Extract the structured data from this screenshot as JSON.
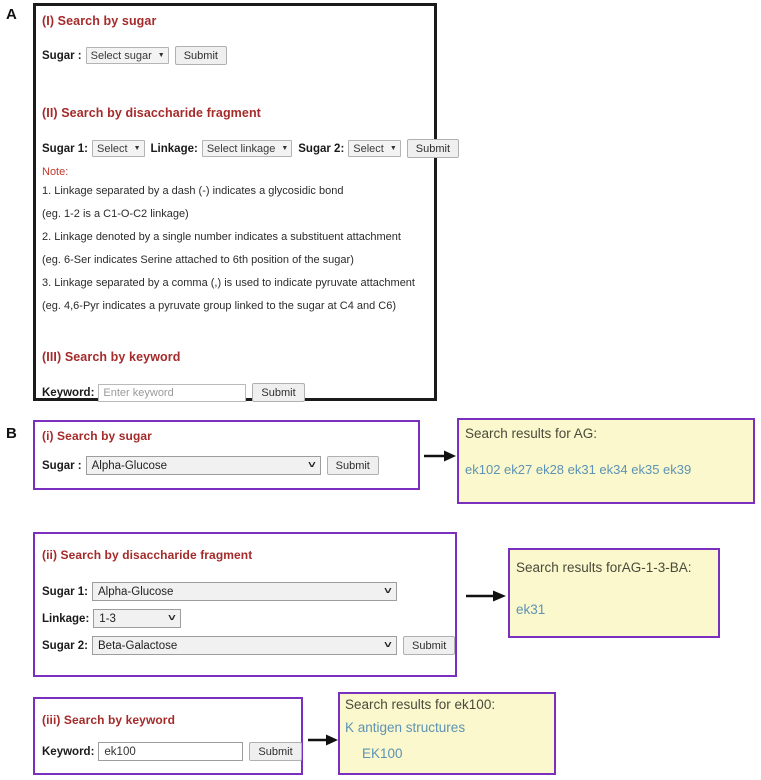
{
  "panels": {
    "a_label": "A",
    "b_label": "B"
  },
  "panel_a": {
    "section1": {
      "heading": "(I) Search by sugar",
      "sugar_label": "Sugar :",
      "sugar_select": "Select sugar",
      "submit": "Submit"
    },
    "section2": {
      "heading": "(II) Search by disaccharide fragment",
      "sugar1_label": "Sugar 1:",
      "sugar1_select": "Select",
      "linkage_label": "Linkage:",
      "linkage_select": "Select linkage",
      "sugar2_label": "Sugar 2:",
      "sugar2_select": "Select",
      "submit": "Submit",
      "note_label": "Note:",
      "notes": [
        "1. Linkage separated by a dash (-) indicates a glycosidic bond",
        "(eg. 1-2 is a C1-O-C2 linkage)",
        "2. Linkage denoted by a single number indicates a substituent attachment",
        "(eg. 6-Ser indicates Serine attached to 6th position of the sugar)",
        "3. Linkage separated by a comma (,) is used to indicate pyruvate attachment",
        "(eg. 4,6-Pyr indicates a pyruvate group linked to the sugar at C4 and C6)"
      ]
    },
    "section3": {
      "heading": "(III) Search by keyword",
      "keyword_label": "Keyword:",
      "keyword_placeholder": "Enter keyword",
      "keyword_value": "",
      "submit": "Submit"
    }
  },
  "panel_b": {
    "section1": {
      "heading": "(i) Search by sugar",
      "sugar_label": "Sugar :",
      "sugar_value": "Alpha-Glucose",
      "submit": "Submit"
    },
    "section2": {
      "heading": "(ii) Search by disaccharide fragment",
      "sugar1_label": "Sugar 1:",
      "sugar1_value": "Alpha-Glucose",
      "linkage_label": "Linkage:",
      "linkage_value": "1-3",
      "sugar2_label": "Sugar 2:",
      "sugar2_value": "Beta-Galactose",
      "submit": "Submit"
    },
    "section3": {
      "heading": "(iii) Search by keyword",
      "keyword_label": "Keyword:",
      "keyword_value": "ek100",
      "submit": "Submit"
    }
  },
  "results": {
    "result1": {
      "title": "Search results for AG:",
      "links": "ek102 ek27 ek28 ek31 ek34 ek35 ek39"
    },
    "result2": {
      "title": "Search results forAG-1-3-BA:",
      "links": "ek31"
    },
    "result3": {
      "title": "Search results for ek100:",
      "link1": "K antigen structures",
      "link2": "EK100"
    }
  },
  "colors": {
    "heading_red": "#a52a2a",
    "note_red": "#c0392b",
    "purple_border": "#7b2fbe",
    "result_yellow": "#faf8cc",
    "link_blue": "#5d93b5",
    "panel_a_border": "#1b1b1b"
  }
}
